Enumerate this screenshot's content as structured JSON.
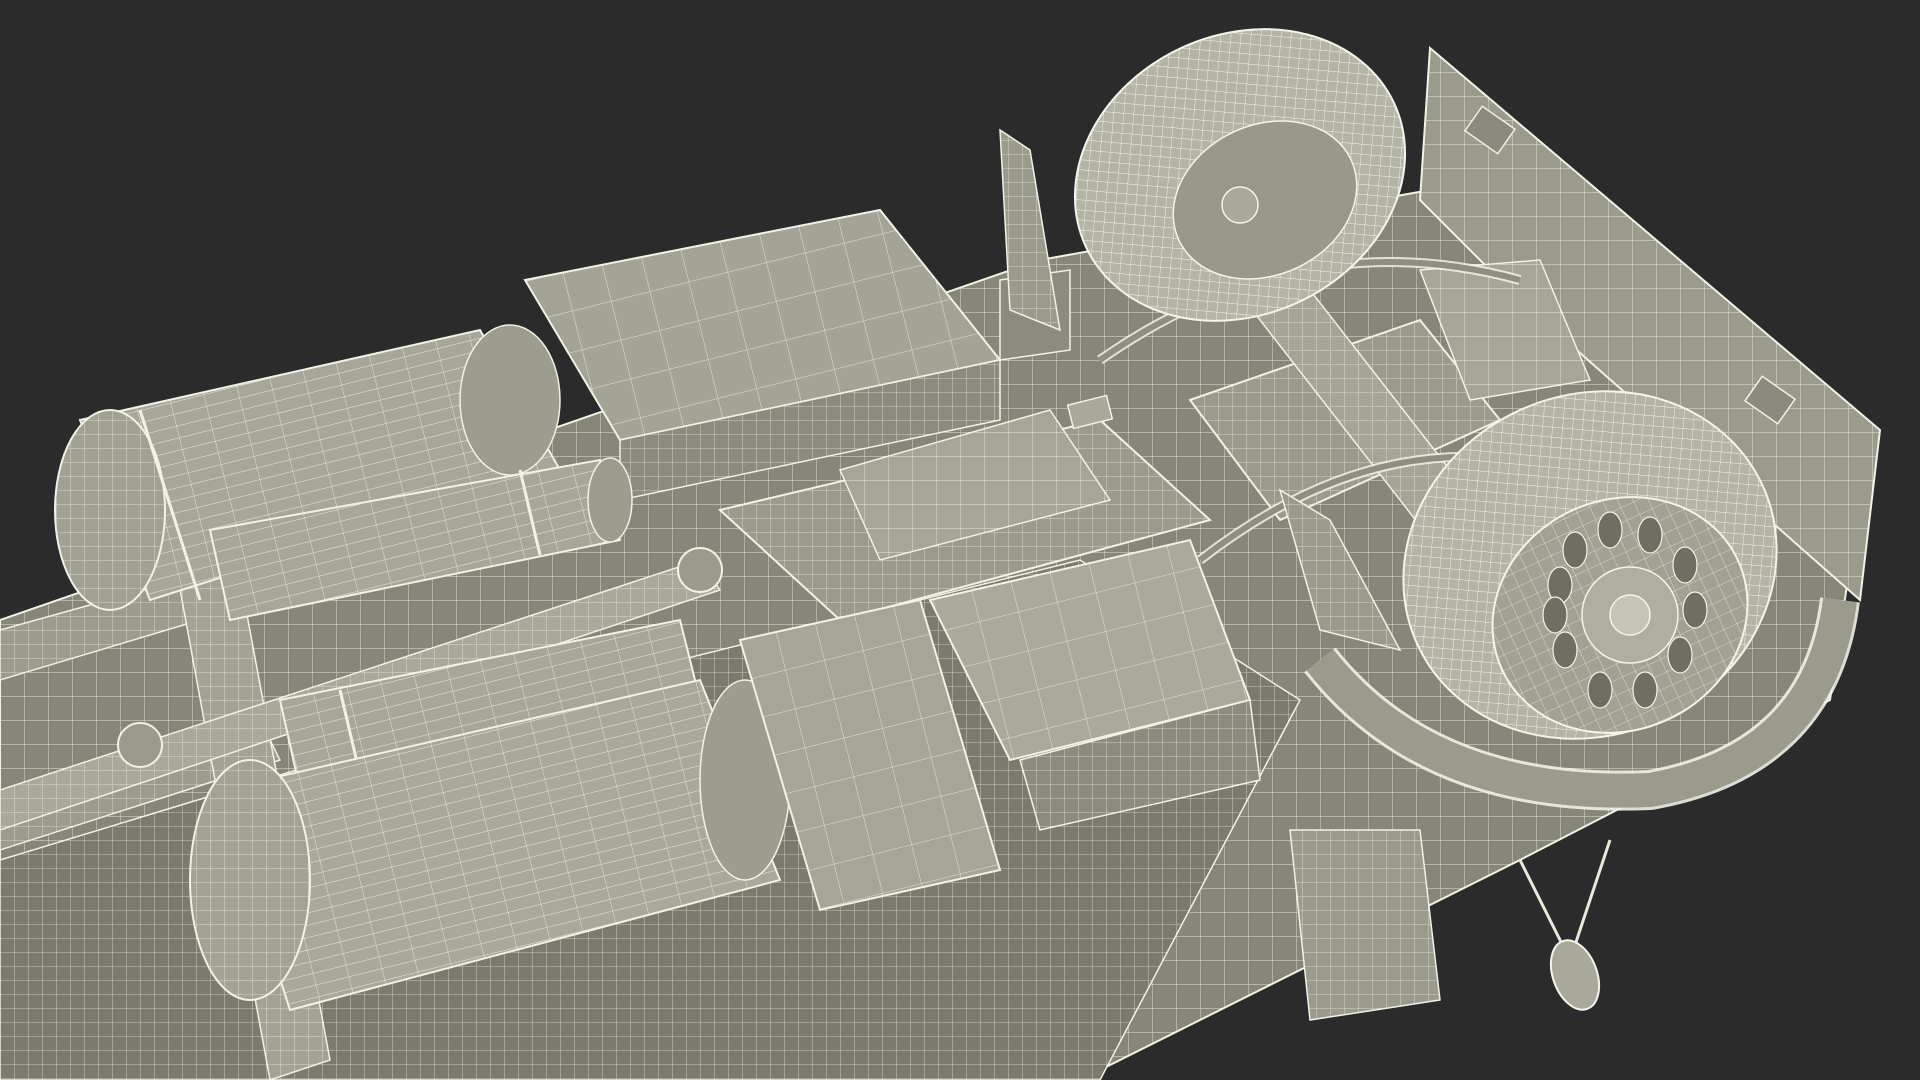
{
  "scene": {
    "colors": {
      "background": "#2b2b2b",
      "body_fill": "#8e8e82",
      "body_fill_light": "#a6a698",
      "body_fill_dark": "#6d6d63",
      "wire": "#f1f1e6",
      "wire_dim": "#cfcfc3"
    }
  }
}
